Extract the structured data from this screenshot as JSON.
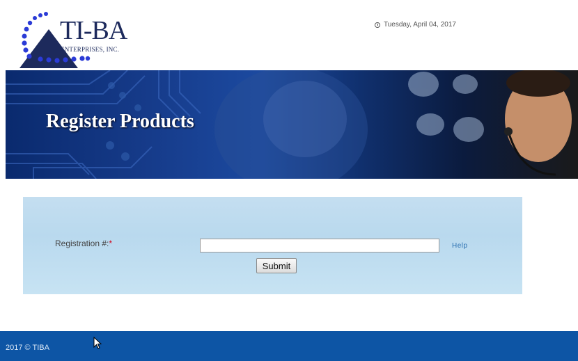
{
  "logo": {
    "title": "TI-BA",
    "subtitle": "ENTERPRISES, INC."
  },
  "header": {
    "date": "Tuesday, April 04, 2017"
  },
  "banner": {
    "title": "Register Products"
  },
  "form": {
    "registration_label": "Registration #:",
    "required_mark": "*",
    "registration_value": "",
    "help_label": "Help",
    "submit_label": "Submit"
  },
  "footer": {
    "copyright": "2017 © TIBA"
  },
  "colors": {
    "brand_navy": "#1d2a5c",
    "footer_blue": "#0d55a5",
    "panel_blue": "#c4def0",
    "link_blue": "#2a6fb0",
    "required_red": "#d0021b"
  }
}
